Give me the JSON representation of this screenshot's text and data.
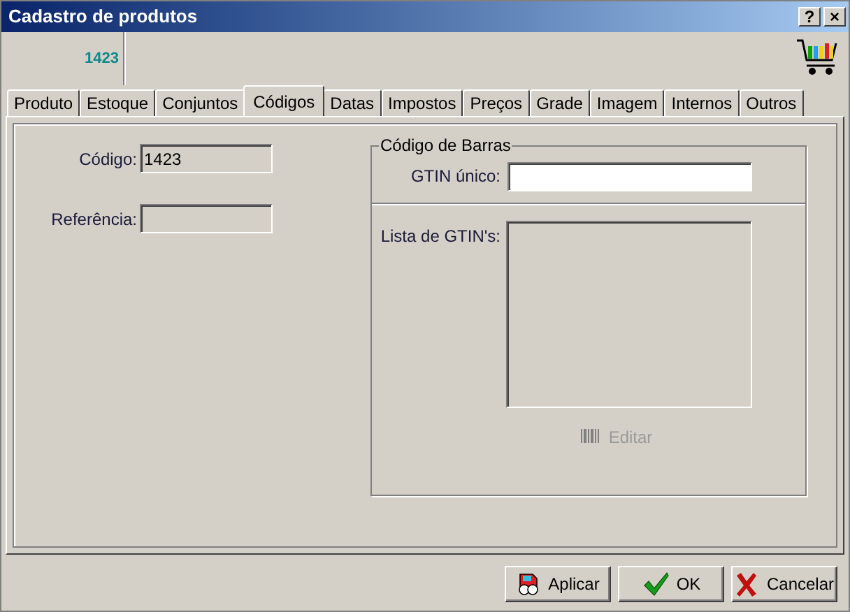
{
  "window": {
    "title": "Cadastro de produtos",
    "title_buttons": [
      "?",
      "×"
    ]
  },
  "header": {
    "code": "1423"
  },
  "tabs": [
    {
      "label": "Produto",
      "selected": false
    },
    {
      "label": "Estoque",
      "selected": false
    },
    {
      "label": "Conjuntos",
      "selected": false
    },
    {
      "label": "Códigos",
      "selected": true
    },
    {
      "label": "Datas",
      "selected": false
    },
    {
      "label": "Impostos",
      "selected": false
    },
    {
      "label": "Preços",
      "selected": false
    },
    {
      "label": "Grade",
      "selected": false
    },
    {
      "label": "Imagem",
      "selected": false
    },
    {
      "label": "Internos",
      "selected": false
    },
    {
      "label": "Outros",
      "selected": false
    }
  ],
  "fields": [
    {
      "label": "Código:",
      "value": "1423",
      "disabled": true
    },
    {
      "label": "Referência:",
      "disabled": true
    }
  ],
  "barcode_group": {
    "title": "Código de Barras",
    "gtin_label": "GTIN único:",
    "list_label": "Lista de GTIN's:",
    "edit_button": {
      "label": "Editar",
      "disabled": true
    }
  },
  "buttons": [
    {
      "label": "Aplicar",
      "kind": "apply"
    },
    {
      "label": "OK",
      "kind": "ok"
    },
    {
      "label": "Cancelar",
      "kind": "cancel"
    }
  ]
}
